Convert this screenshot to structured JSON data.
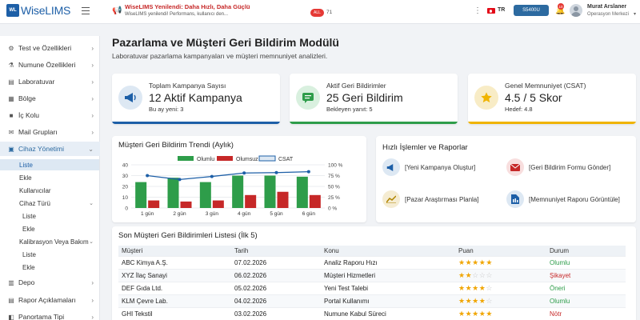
{
  "app": {
    "badge": "WL",
    "name": "WiseLIMS"
  },
  "announcement": {
    "title": "WiseLIMS Yenilendi: Daha Hızlı, Daha Güçlü",
    "subtitle": "WiseLIMS yenilendi! Performans, kullanıcı den...",
    "all_label": "ALL",
    "count": "71"
  },
  "topbar": {
    "lang": "TR",
    "id_button": "S5400U",
    "bell_count": "10",
    "user_name": "Murat Arslaner",
    "user_role": "Operasyon Merkezi"
  },
  "sidebar": {
    "items": [
      {
        "label": "Test ve Özellikleri",
        "icon": "gear-icon"
      },
      {
        "label": "Numune Özellikleri",
        "icon": "flask-icon"
      },
      {
        "label": "Laboratuvar",
        "icon": "building-icon"
      },
      {
        "label": "Bölge",
        "icon": "map-icon"
      },
      {
        "label": "İç Kolu",
        "icon": "badge-icon"
      },
      {
        "label": "Mail Grupları",
        "icon": "mail-icon"
      },
      {
        "label": "Cihaz Yönetimi",
        "icon": "device-icon"
      }
    ],
    "sub": [
      "Liste",
      "Ekle",
      "Kullanıcılar",
      "Cihaz Türü",
      "Liste",
      "Ekle",
      "Kalibrasyon Veya Bakım",
      "Liste",
      "Ekle"
    ],
    "bottom": [
      {
        "label": "Depo",
        "icon": "warehouse-icon"
      },
      {
        "label": "Rapor Açıklamaları",
        "icon": "report-icon"
      },
      {
        "label": "Panortama Tipi",
        "icon": "type-icon"
      }
    ]
  },
  "page": {
    "title": "Pazarlama ve Müşteri Geri Bildirim Modülü",
    "subtitle": "Laboratuvar pazarlama kampanyaları ve müşteri memnuniyet analizleri."
  },
  "stats": [
    {
      "label": "Toplam Kampanya Sayısı",
      "value": "12 Aktif Kampanya",
      "sub": "Bu ay yeni: 3",
      "color": "#1d5fa7",
      "icon": "megaphone-icon"
    },
    {
      "label": "Aktif Geri Bildirimler",
      "value": "25 Geri Bildirim",
      "sub": "Bekleyen yanıt: 5",
      "color": "#2e9d4a",
      "icon": "chat-icon"
    },
    {
      "label": "Genel Memnuniyet (CSAT)",
      "value": "4.5 / 5 Skor",
      "sub": "Hedef: 4.8",
      "color": "#f0b400",
      "icon": "star-icon"
    }
  ],
  "chart_data": {
    "type": "bar",
    "title": "Müşteri Geri Bildirim Trendi (Aylık)",
    "categories": [
      "1 gün",
      "2 gün",
      "3 gün",
      "4 gün",
      "5 gün",
      "6 gün"
    ],
    "series": [
      {
        "name": "Olumlu",
        "type": "bar",
        "axis": "left",
        "color": "#2e9d4a",
        "values": [
          24,
          28,
          24,
          30,
          30,
          29
        ]
      },
      {
        "name": "Olumsuz",
        "type": "bar",
        "axis": "left",
        "color": "#c62828",
        "values": [
          7,
          6,
          7,
          12,
          15,
          12
        ]
      },
      {
        "name": "CSAT",
        "type": "line",
        "axis": "right",
        "color": "#1d5fa7",
        "values": [
          75,
          66,
          73,
          81,
          82,
          84
        ]
      }
    ],
    "ylim_left": [
      0,
      40
    ],
    "yticks_left": [
      0,
      10,
      20,
      30,
      40
    ],
    "ylim_right": [
      0,
      100
    ],
    "yticks_right": [
      "0 %",
      "25 %",
      "50 %",
      "75 %",
      "100 %"
    ],
    "legend": "top",
    "grid": true
  },
  "quick_actions": {
    "title": "Hızlı İşlemler ve Raporlar",
    "items": [
      {
        "label": "[Yeni Kampanya Oluştur]",
        "icon": "megaphone-icon",
        "bg": "#dde8f3",
        "fg": "#1d5fa7"
      },
      {
        "label": "[Geri Bildirim Formu Gönder]",
        "icon": "mail-icon",
        "bg": "#f8dede",
        "fg": "#c62828"
      },
      {
        "label": "[Pazar Araştırması Planla]",
        "icon": "chart-icon",
        "bg": "#f5ecd2",
        "fg": "#b08500"
      },
      {
        "label": "[Memnuniyet Raporu Görüntüle]",
        "icon": "document-icon",
        "bg": "#dde8f3",
        "fg": "#1d5fa7"
      }
    ]
  },
  "feedback": {
    "title": "Son Müşteri Geri Bildirimleri Listesi (İlk 5)",
    "columns": [
      "Müşteri",
      "Tarih",
      "Konu",
      "Puan",
      "Durum"
    ],
    "rows": [
      {
        "customer": "ABC Kimya A.Ş.",
        "date": "07.02.2026",
        "topic": "Analiz Raporu Hızı",
        "rating": 5,
        "status": "Olumlu",
        "status_color": "#2e9d4a"
      },
      {
        "customer": "XYZ İlaç Sanayi",
        "date": "06.02.2026",
        "topic": "Müşteri Hizmetleri",
        "rating": 2,
        "status": "Şikayet",
        "status_color": "#c62828"
      },
      {
        "customer": "DEF Gıda Ltd.",
        "date": "05.02.2026",
        "topic": "Yeni Test Talebi",
        "rating": 4,
        "status": "Öneri",
        "status_color": "#2e9d4a"
      },
      {
        "customer": "KLM Çevre Lab.",
        "date": "04.02.2026",
        "topic": "Portal Kullanımı",
        "rating": 4,
        "status": "Olumlu",
        "status_color": "#2e9d4a"
      },
      {
        "customer": "GHI Tekstil",
        "date": "03.02.2026",
        "topic": "Numune Kabul Süreci",
        "rating": 5,
        "status": "Nötr",
        "status_color": "#c62828"
      }
    ]
  }
}
